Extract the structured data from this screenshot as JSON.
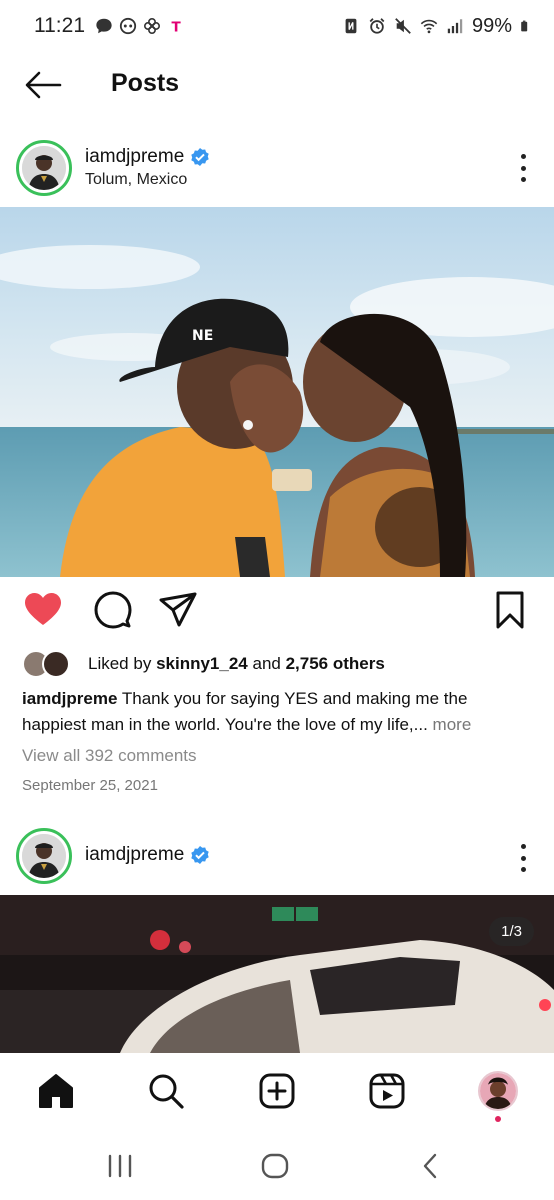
{
  "status_bar": {
    "time": "11:21",
    "carrier_glyph": "T",
    "battery": "99%",
    "icons": [
      "chat-icon",
      "messenger-icon",
      "pinwheel-icon",
      "tmobile-icon",
      "nfc-icon",
      "alarm-icon",
      "mute-icon",
      "wifi-icon",
      "signal-icon",
      "battery-icon"
    ]
  },
  "header": {
    "title": "Posts",
    "back_icon": "arrow-left-icon"
  },
  "posts": [
    {
      "username": "iamdjpreme",
      "verified": true,
      "location": "Tolum, Mexico",
      "liked_by": "skinny1_24",
      "liked_prefix": "Liked by",
      "liked_and": "and",
      "likes_others": "2,756 others",
      "caption_user": "iamdjpreme",
      "caption_line1": "Thank you for saying YES and making me the",
      "caption_line2": "happiest man in the world. You're the love of my life,...",
      "caption_more": "more",
      "view_comments": "View all 392 comments",
      "date": "September 25, 2021",
      "liked": true
    },
    {
      "username": "iamdjpreme",
      "verified": true,
      "carousel_counter": "1/3"
    }
  ],
  "colors": {
    "like_red": "#ed4956",
    "verified_blue": "#3897f0",
    "story_ring_green": "#3ac05a",
    "notification_dot": "#e0245e"
  },
  "bottom_nav": [
    "home-icon",
    "search-icon",
    "create-icon",
    "reels-icon",
    "profile-avatar"
  ],
  "system_nav": [
    "recents-icon",
    "home-circle-icon",
    "back-chevron-icon"
  ]
}
